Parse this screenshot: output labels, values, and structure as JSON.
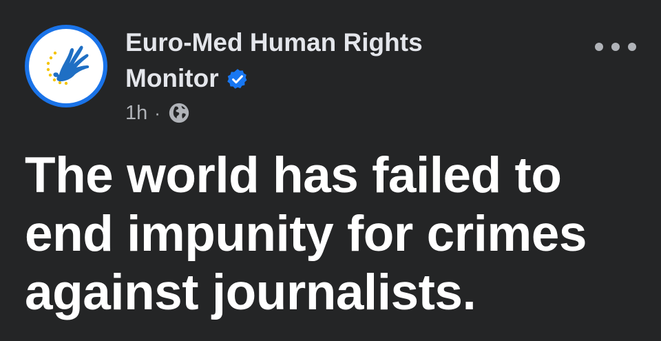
{
  "post": {
    "author": {
      "name": "Euro-Med Human Rights Monitor",
      "verified_icon": "verified-badge-icon",
      "verified_color": "#1877f2",
      "avatar_icon": "euro-med-dove-hand-logo",
      "avatar_ring_color": "#1a73e8"
    },
    "meta": {
      "time": "1h",
      "separator": "·",
      "audience_icon": "globe-icon"
    },
    "menu": {
      "icon": "more-options-icon"
    },
    "text": "The world has failed to end impunity for crimes against journalists."
  },
  "theme": {
    "background": "#242526",
    "primary_text": "#e4e6eb",
    "secondary_text": "#b0b3b8"
  }
}
